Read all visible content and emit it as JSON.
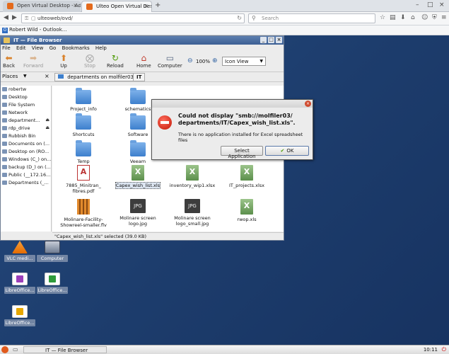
{
  "browser": {
    "tabs": [
      {
        "label": "Open Virtual Desktop - Ad..."
      },
      {
        "label": "Ulteo Open Virtual Desktop"
      }
    ],
    "url": "ulteoweb/ovd/",
    "search_placeholder": "Search",
    "bookmark": "Robert Wild - Outlook..."
  },
  "file_browser": {
    "title": "IT — File Browser",
    "menu": [
      "File",
      "Edit",
      "View",
      "Go",
      "Bookmarks",
      "Help"
    ],
    "toolbar": {
      "back": "Back",
      "forward": "Forward",
      "up": "Up",
      "stop": "Stop",
      "reload": "Reload",
      "home": "Home",
      "computer": "Computer",
      "zoom": "100%",
      "view_mode": "Icon View"
    },
    "places_header": "Places",
    "path": [
      "departments on molfiler03",
      "IT"
    ],
    "places": [
      {
        "label": "robertw",
        "eject": ""
      },
      {
        "label": "Desktop",
        "eject": ""
      },
      {
        "label": "File System",
        "eject": ""
      },
      {
        "label": "Network",
        "eject": ""
      },
      {
        "label": "department...",
        "eject": "⏏"
      },
      {
        "label": "rdp_drive",
        "eject": "⏏"
      },
      {
        "label": "Rubbish Bin",
        "eject": ""
      },
      {
        "label": "Documents on (...",
        "eject": ""
      },
      {
        "label": "Desktop on (RO...",
        "eject": ""
      },
      {
        "label": "Windows (C_) on...",
        "eject": ""
      },
      {
        "label": "backup (D_) on (...",
        "eject": ""
      },
      {
        "label": "Public (__172.16....",
        "eject": ""
      },
      {
        "label": "Departments (_...",
        "eject": ""
      }
    ],
    "files": [
      {
        "name": "Project_info",
        "type": "folder"
      },
      {
        "name": "schematics",
        "type": "folder"
      },
      {
        "name": "Shortcuts",
        "type": "folder"
      },
      {
        "name": "Software",
        "type": "folder"
      },
      {
        "name": "Temp",
        "type": "folder"
      },
      {
        "name": "Veeam",
        "type": "folder"
      },
      {
        "name": "7885_Minitran_ fibres.pdf",
        "type": "pdf"
      },
      {
        "name": "Capex_wish_list.xls",
        "type": "xls"
      },
      {
        "name": "inventory_wip1.xlsx",
        "type": "xls"
      },
      {
        "name": "IT_projects.xlsx",
        "type": "xls"
      },
      {
        "name": "Molinare-Facility-Showreel-smaller.flv",
        "type": "flv"
      },
      {
        "name": "Molinare screen logo.jpg",
        "type": "jpg"
      },
      {
        "name": "Molinare screen logo_small.jpg",
        "type": "jpg"
      },
      {
        "name": "rwop.xls",
        "type": "xls"
      }
    ],
    "status": "\"Capex_wish_list.xls\" selected (39.0 KB)"
  },
  "dialog": {
    "heading": "Could not display \"smb://molfiler03/ departments/IT/Capex_wish_list.xls\".",
    "message": "There is no application installed for Excel spreadsheet files",
    "select_button": "Select Application",
    "ok_button": "OK"
  },
  "desktop_icons": [
    {
      "label": "VLC medi..."
    },
    {
      "label": "Computer"
    },
    {
      "label": "LibreOffice..."
    },
    {
      "label": "LibreOffice..."
    },
    {
      "label": "LibreOffice..."
    }
  ],
  "taskbar": {
    "task": "IT — File Browser",
    "clock": "10:11"
  }
}
